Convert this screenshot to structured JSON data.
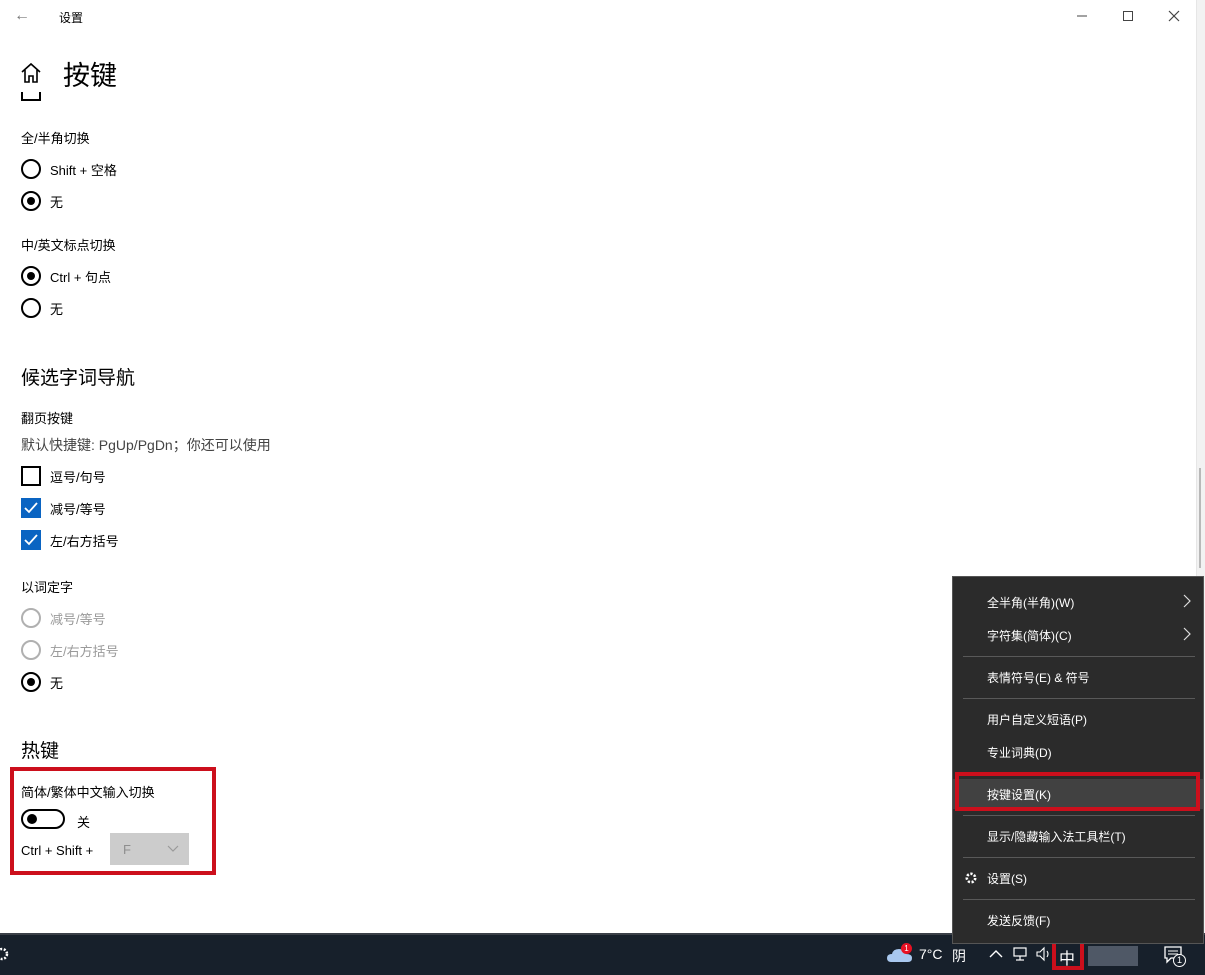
{
  "window": {
    "app_title": "设置",
    "page_title": "按键"
  },
  "sections": {
    "full_half": {
      "label": "全/半角切换",
      "options": [
        "Shift + 空格",
        "无"
      ]
    },
    "punct": {
      "label": "中/英文标点切换",
      "options": [
        "Ctrl + 句点",
        "无"
      ]
    },
    "candidate_nav": {
      "heading": "候选字词导航",
      "page_keys_label": "翻页按键",
      "hint": "默认快捷键: PgUp/PgDn；你还可以使用",
      "checkboxes": [
        {
          "label": "逗号/句号",
          "checked": false
        },
        {
          "label": "减号/等号",
          "checked": true
        },
        {
          "label": "左/右方括号",
          "checked": true
        }
      ]
    },
    "select_by_word": {
      "label": "以词定字",
      "options": [
        {
          "label": "减号/等号",
          "enabled": false,
          "selected": false
        },
        {
          "label": "左/右方括号",
          "enabled": false,
          "selected": false
        },
        {
          "label": "无",
          "enabled": true,
          "selected": true
        }
      ]
    },
    "hotkeys": {
      "heading": "热键",
      "switch_label": "简体/繁体中文输入切换",
      "toggle_state": "关",
      "toggle_on": false,
      "combo_prefix": "Ctrl + Shift +",
      "combo_key": "F"
    }
  },
  "context_menu": {
    "items": [
      {
        "label": "全半角(半角)(W)",
        "submenu": true
      },
      {
        "label": "字符集(简体)(C)",
        "submenu": true
      },
      {
        "label": "表情符号(E) & 符号"
      },
      {
        "label": "用户自定义短语(P)"
      },
      {
        "label": "专业词典(D)"
      },
      {
        "label": "按键设置(K)",
        "highlighted": true
      },
      {
        "label": "显示/隐藏输入法工具栏(T)"
      },
      {
        "label": "设置(S)",
        "icon": "gear-icon"
      },
      {
        "label": "发送反馈(F)"
      }
    ]
  },
  "taskbar": {
    "weather_temp": "7°C",
    "weather_text": "阴",
    "weather_badge": "1",
    "ime_indicator": "中",
    "notification_count": "1"
  },
  "colors": {
    "accent": "#0a64c2",
    "highlight_red": "#cc0f1c",
    "taskbar_bg": "#17202b",
    "menu_bg": "#2b2b2b"
  }
}
